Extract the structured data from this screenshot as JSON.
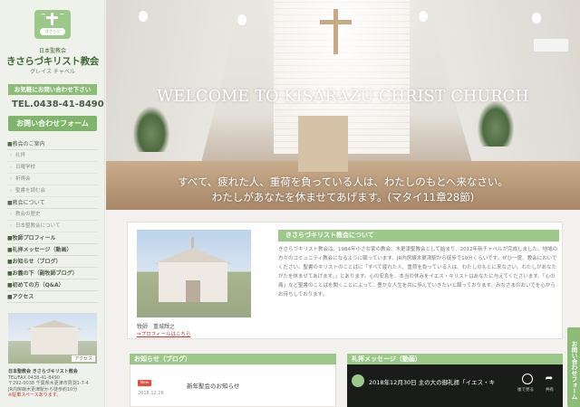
{
  "sidebar": {
    "logo_tag": "きさらづ",
    "denomination": "日本聖教会",
    "church_name": "きさらづキリスト教会",
    "church_kana": "グレイス チャペル",
    "contact_label": "お気軽にお問い合わせ下さい",
    "tel": "TEL.0438-41-8490",
    "form_label": "お問い合わせフォーム",
    "nav": [
      {
        "kind": "sect",
        "label": "■教会のご案内"
      },
      {
        "kind": "sub",
        "label": "礼拝"
      },
      {
        "kind": "sub",
        "label": "日曜学校"
      },
      {
        "kind": "sub",
        "label": "祈祷会"
      },
      {
        "kind": "sub",
        "label": "聖書を読む会"
      },
      {
        "kind": "sect",
        "label": "■教会について"
      },
      {
        "kind": "sub",
        "label": "教会の歴史"
      },
      {
        "kind": "sub",
        "label": "日本聖教会について"
      },
      {
        "kind": "main",
        "label": "■牧師プロフィール"
      },
      {
        "kind": "main",
        "label": "■礼拝メッセージ（動画）"
      },
      {
        "kind": "main",
        "label": "■お知らせ（ブログ）"
      },
      {
        "kind": "main",
        "label": "■お義の下（副牧師ブログ）"
      },
      {
        "kind": "main",
        "label": "■初めての方（Q&A）"
      },
      {
        "kind": "main",
        "label": "■アクセス"
      }
    ],
    "photo_tag": "アクセス",
    "address": [
      "日本聖教会 きさらづキリスト教会",
      "TEL/FAX 0438-41-8490",
      "〒292-0038 千葉県木更津市貝渕1-7-4",
      "JR内房線木更津駅から徒歩約10分",
      "※駐車スペースあります。"
    ]
  },
  "hero": {
    "title": "WELCOME TO KISARAZU CHRIST CHURCH",
    "verse_line1": "すべて、疲れた人、重荷を負っている人は、わたしのもとへ来なさい。",
    "verse_line2": "わたしがあなたを休ませてあげます。(マタイ11章28節)"
  },
  "about": {
    "heading": "きさらづキリスト教会について",
    "text": "きさらづキリスト教会は、1984年小さな家の教会、木更津聖教会として始まり、2012年新チャペルが完成しました。地域の方々のコミュニティ教会になるように願っています。JR内房線木更津駅から徒歩で10分くらいです。ぜひ一度、教会においでください。聖書のキリストのことばに「すべて疲れた人、重荷を負っている人は、わたしのもとに来なさい。わたしがあなたがたを休ませてあげます。」とあります。心の安息を、本当の休みをイエス・キリストはあなたに与えてくださいます。「心の痛」など聖書のことばを聞くことによって、豊かな人生を共に歩んでいきたいと願っております。みなさまのおいでを心からお待ちしております。",
    "pastor": "牧師　重城輝之",
    "profile_link": "⇒プロフィールはこちら"
  },
  "news": {
    "heading": "お知らせ（ブログ）",
    "badge": "New",
    "item_title": "新年聖会のお知らせ",
    "item_date": "2018.12.26"
  },
  "video": {
    "heading": "礼拝メッセージ（動画）",
    "title": "2018年12月30日 主の大の御礼拝「イエス・キ",
    "later_label": "後で見る",
    "share_label": "共有"
  },
  "float_contact": "お問い合わせフォーム"
}
